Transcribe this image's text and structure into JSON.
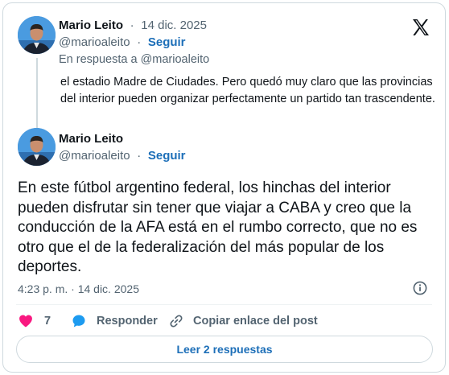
{
  "reply_tweet": {
    "author_name": "Mario Leito",
    "date_sep": "·",
    "date": "14 dic. 2025",
    "handle": "@marioaleito",
    "follow_sep": "·",
    "follow_label": "Seguir",
    "in_reply_to": "En respuesta a @marioaleito",
    "text": "el estadio Madre de Ciudades. Pero quedó muy claro que las provincias del interior pueden organizar perfectamente un partido tan trascendente."
  },
  "main_tweet": {
    "author_name": "Mario Leito",
    "handle": "@marioaleito",
    "follow_sep": "·",
    "follow_label": "Seguir",
    "text": "En este fútbol argentino federal, los hinchas del interior pueden disfrutar sin tener que viajar a CABA y creo que la conducción de la AFA está en el rumbo  correcto, que no es otro que el de la federalización del más popular de los deportes.",
    "timestamp": "4:23 p. m. · 14 dic. 2025"
  },
  "actions": {
    "like_count": "7",
    "reply_label": "Responder",
    "copy_link_label": "Copiar enlace del post"
  },
  "read_replies_label": "Leer 2 respuestas",
  "icons": {
    "brand": "x-logo-icon",
    "info": "info-icon",
    "like": "heart-icon",
    "reply": "speech-bubble-icon",
    "link": "link-icon"
  },
  "colors": {
    "accent": "#1d6fb8",
    "like": "#f91880",
    "reply": "#1d9bf0",
    "muted": "#536471",
    "border": "#cfd9de"
  }
}
